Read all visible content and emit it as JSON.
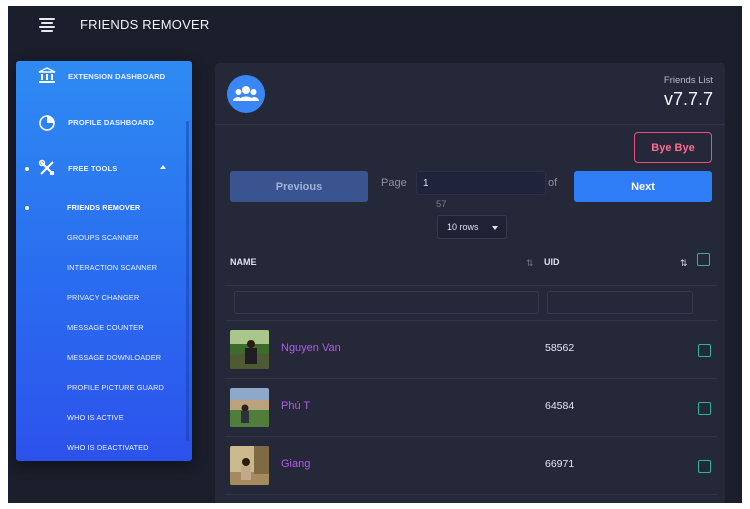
{
  "app": {
    "title": "FRIENDS REMOVER"
  },
  "sidebar": {
    "items": [
      {
        "label": "EXTENSION DASHBOARD",
        "icon": "bank-icon"
      },
      {
        "label": "PROFILE DASHBOARD",
        "icon": "pie-chart-icon"
      },
      {
        "label": "FREE TOOLS",
        "icon": "tools-icon",
        "expanded": true
      }
    ],
    "subitems": [
      {
        "label": "FRIENDS REMOVER",
        "active": true
      },
      {
        "label": "GROUPS SCANNER"
      },
      {
        "label": "INTERACTION SCANNER"
      },
      {
        "label": "PRIVACY CHANGER"
      },
      {
        "label": "MESSAGE COUNTER"
      },
      {
        "label": "MESSAGE DOWNLOADER"
      },
      {
        "label": "PROFILE PICTURE GUARD"
      },
      {
        "label": "WHO IS ACTIVE"
      },
      {
        "label": "WHO IS DEACTIVATED"
      }
    ]
  },
  "header": {
    "subtitle": "Friends List",
    "version": "v7.7.7",
    "bye_label": "Bye Bye"
  },
  "pagination": {
    "prev_label": "Previous",
    "page_label": "Page",
    "page_value": "1",
    "of_label": "of",
    "total_pages": "57",
    "next_label": "Next",
    "rows_label": "10 rows"
  },
  "table": {
    "columns": [
      "NAME",
      "UID"
    ],
    "sort_icon": "sort-icon",
    "rows": [
      {
        "name": "Nguyen Van",
        "uid": "58562"
      },
      {
        "name": "Phú T",
        "uid": "64584"
      },
      {
        "name": "Giang",
        "uid": "66971"
      }
    ]
  },
  "colors": {
    "accent": "#2f7df6",
    "danger": "#e4527c",
    "link": "#b15de8",
    "check": "#2fb49c"
  }
}
